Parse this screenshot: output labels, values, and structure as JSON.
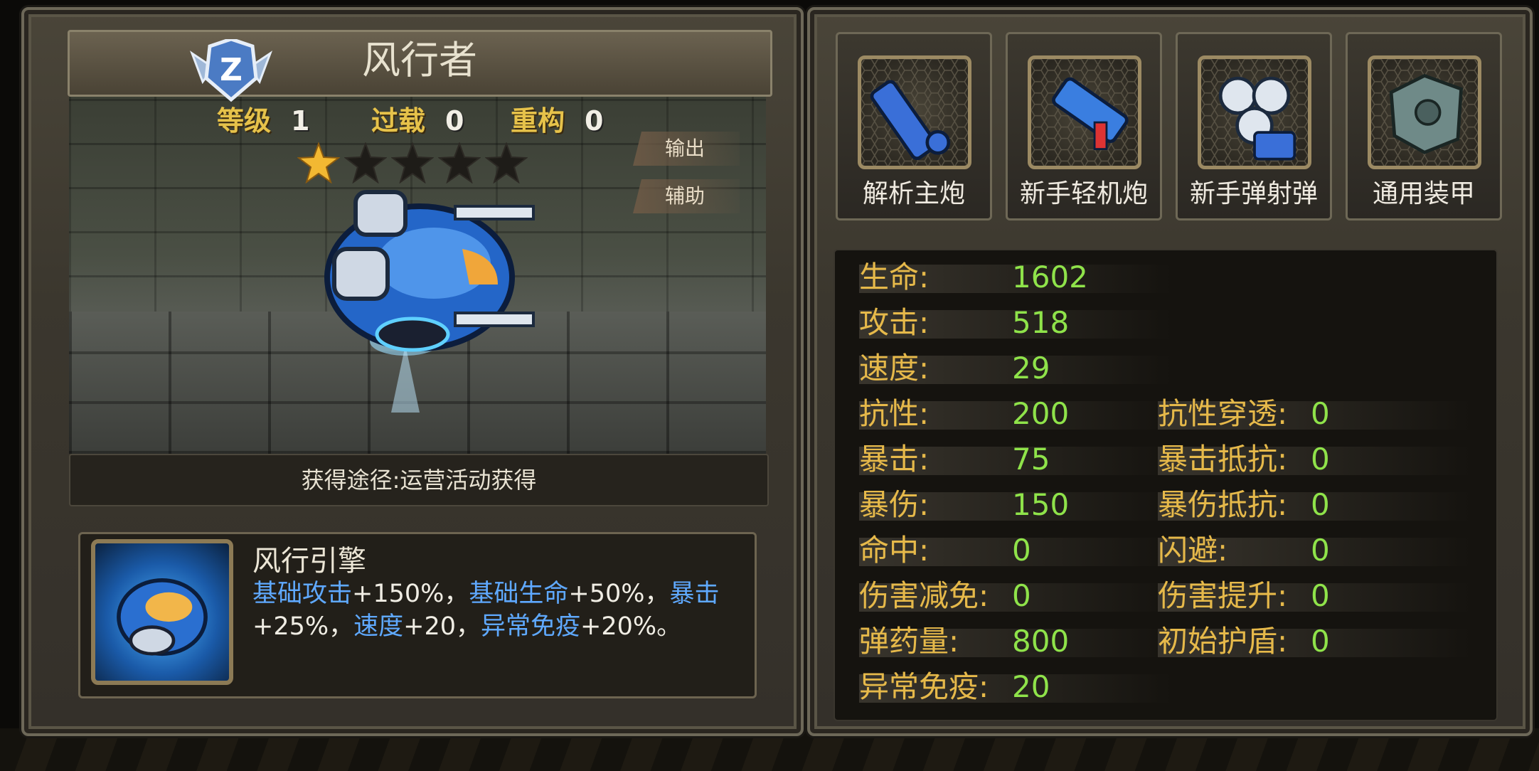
{
  "character": {
    "name": "风行者",
    "rank_letter": "Z",
    "level_label": "等级",
    "level": "1",
    "overload_label": "过载",
    "overload": "0",
    "rebuild_label": "重构",
    "rebuild": "0",
    "stars_filled": 1,
    "stars_total": 5
  },
  "tabs": {
    "output": "输出",
    "support": "辅助"
  },
  "source": "获得途径:运营活动获得",
  "engine": {
    "name": "风行引擎",
    "desc": [
      {
        "text": "基础攻击",
        "hl": true
      },
      {
        "text": "+150%，",
        "hl": false
      },
      {
        "text": "基础生命",
        "hl": true
      },
      {
        "text": "+50%，",
        "hl": false
      },
      {
        "text": "暴击",
        "hl": true
      },
      {
        "text": "+25%，",
        "hl": false
      },
      {
        "text": "速度",
        "hl": true
      },
      {
        "text": "+20，",
        "hl": false
      },
      {
        "text": "异常免疫",
        "hl": true
      },
      {
        "text": "+20%。",
        "hl": false
      }
    ]
  },
  "equipment": [
    {
      "label": "解析主炮",
      "icon": "main-cannon-icon"
    },
    {
      "label": "新手轻机炮",
      "icon": "light-machine-gun-icon"
    },
    {
      "label": "新手弹射弹",
      "icon": "ricochet-launcher-icon"
    },
    {
      "label": "通用装甲",
      "icon": "armor-icon"
    }
  ],
  "stats_left": [
    {
      "label": "生命:",
      "value": "1602"
    },
    {
      "label": "攻击:",
      "value": "518"
    },
    {
      "label": "速度:",
      "value": "29"
    },
    {
      "label": "抗性:",
      "value": "200"
    },
    {
      "label": "暴击:",
      "value": "75"
    },
    {
      "label": "暴伤:",
      "value": "150"
    },
    {
      "label": "命中:",
      "value": "0"
    },
    {
      "label": "伤害减免:",
      "value": "0"
    },
    {
      "label": "弹药量:",
      "value": "800"
    },
    {
      "label": "异常免疫:",
      "value": "20"
    }
  ],
  "stats_right": [
    {
      "label": "抗性穿透:",
      "value": "0"
    },
    {
      "label": "暴击抵抗:",
      "value": "0"
    },
    {
      "label": "暴伤抵抗:",
      "value": "0"
    },
    {
      "label": "闪避:",
      "value": "0"
    },
    {
      "label": "伤害提升:",
      "value": "0"
    },
    {
      "label": "初始护盾:",
      "value": "0"
    }
  ],
  "colors": {
    "label": "#e6b94a",
    "value": "#8fe34a",
    "highlight": "#5fa9ff"
  }
}
